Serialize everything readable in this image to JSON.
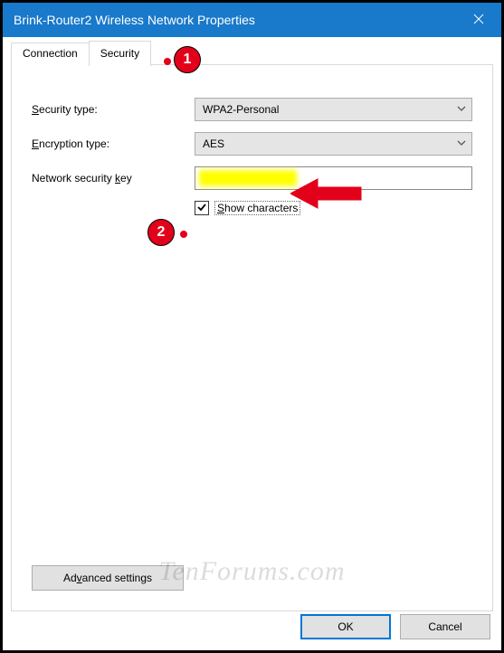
{
  "window": {
    "title": "Brink-Router2 Wireless Network Properties"
  },
  "tabs": {
    "connection": "Connection",
    "security": "Security"
  },
  "fields": {
    "security_type_label_a": "S",
    "security_type_label_b": "ecurity type:",
    "security_type_value": "WPA2-Personal",
    "encryption_label_a": "E",
    "encryption_label_b": "ncryption type:",
    "encryption_value": "AES",
    "key_label_a": "Network security ",
    "key_label_b": "k",
    "key_label_c": "ey",
    "key_value": ""
  },
  "show_characters": {
    "checked": true,
    "label_a": "S",
    "label_b": "how characters"
  },
  "advanced": {
    "label_a": "Ad",
    "label_b": "v",
    "label_c": "anced settings"
  },
  "buttons": {
    "ok": "OK",
    "cancel": "Cancel"
  },
  "callouts": {
    "c1": "1",
    "c2": "2"
  },
  "watermark": "TenForums.com"
}
